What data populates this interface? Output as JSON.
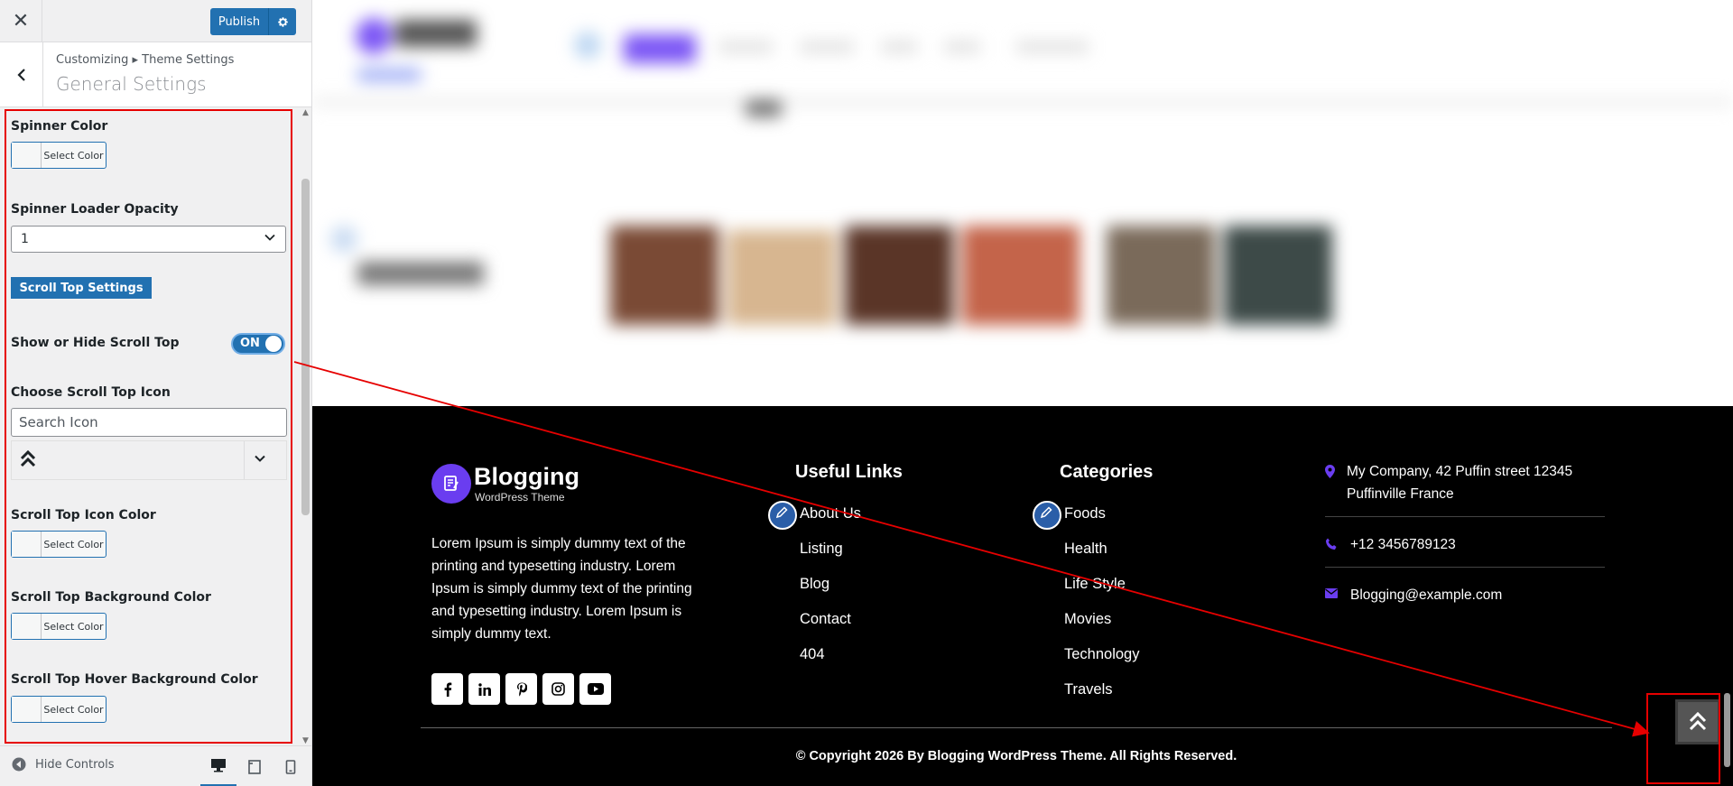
{
  "customizer": {
    "close_icon": "close-icon",
    "publish_label": "Publish",
    "settings_icon": "gear-icon",
    "breadcrumb": "Customizing ▸ Theme Settings",
    "section_title": "General Settings",
    "spinner_color_label": "Spinner Color",
    "select_color": "Select Color",
    "spinner_opacity_label": "Spinner Loader Opacity",
    "spinner_opacity_value": "1",
    "scroll_top_settings": "Scroll Top Settings",
    "show_hide_label": "Show or Hide Scroll Top",
    "toggle_text": "ON",
    "choose_icon_label": "Choose Scroll Top Icon",
    "icon_search_placeholder": "Search Icon",
    "icon_color_label": "Scroll Top Icon Color",
    "bg_color_label": "Scroll Top Background Color",
    "hover_bg_color_label": "Scroll Top Hover Background Color",
    "hide_controls": "Hide Controls"
  },
  "site_footer": {
    "logo_name": "Blogging",
    "logo_tagline": "WordPress Theme",
    "about_text": "Lorem Ipsum is simply dummy text of the printing and typesetting industry. Lorem Ipsum is simply dummy text of the printing and typesetting industry. Lorem Ipsum is simply dummy text.",
    "social_icons": [
      "facebook-icon",
      "linkedin-icon",
      "pinterest-icon",
      "instagram-icon",
      "youtube-icon"
    ],
    "useful_links_title": "Useful Links",
    "useful_links": [
      "About Us",
      "Listing",
      "Blog",
      "Contact",
      "404"
    ],
    "categories_title": "Categories",
    "categories": [
      "Foods",
      "Health",
      "Life Style",
      "Movies",
      "Technology",
      "Travels"
    ],
    "address": "My Company, 42 Puffin street 12345 Puffinville France",
    "phone": "+12 3456789123",
    "email": "Blogging@example.com",
    "copyright": "© Copyright 2026 By Blogging WordPress Theme. All Rights Reserved."
  },
  "colors": {
    "wp_blue": "#2271b1",
    "accent_purple": "#6a3df0",
    "annotation_red": "#e60000"
  }
}
